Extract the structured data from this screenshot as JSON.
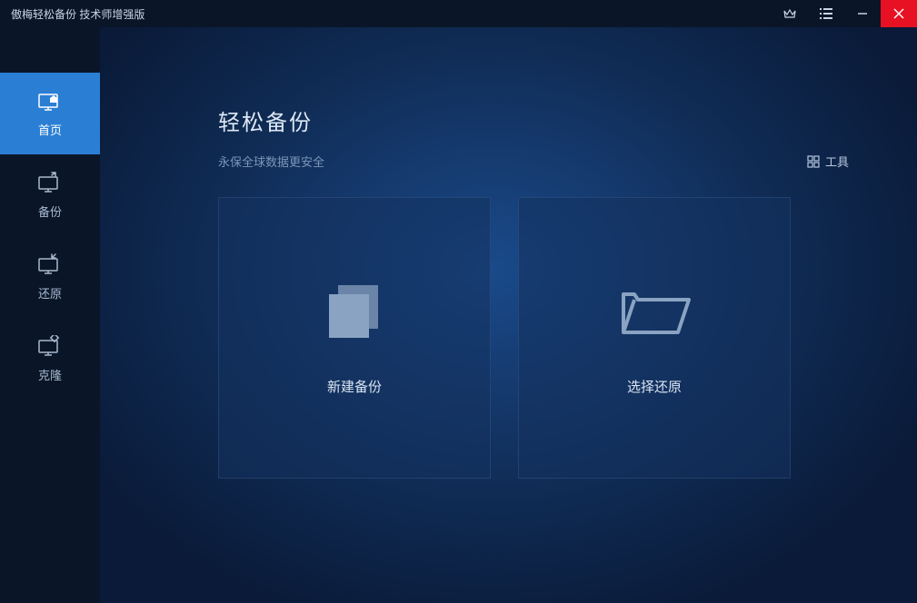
{
  "titlebar": {
    "title": "傲梅轻松备份 技术师增强版"
  },
  "sidebar": {
    "items": [
      {
        "label": "首页"
      },
      {
        "label": "备份"
      },
      {
        "label": "还原"
      },
      {
        "label": "克隆"
      }
    ]
  },
  "main": {
    "title": "轻松备份",
    "subtitle": "永保全球数据更安全",
    "tools_label": "工具",
    "cards": [
      {
        "label": "新建备份"
      },
      {
        "label": "选择还原"
      }
    ]
  }
}
